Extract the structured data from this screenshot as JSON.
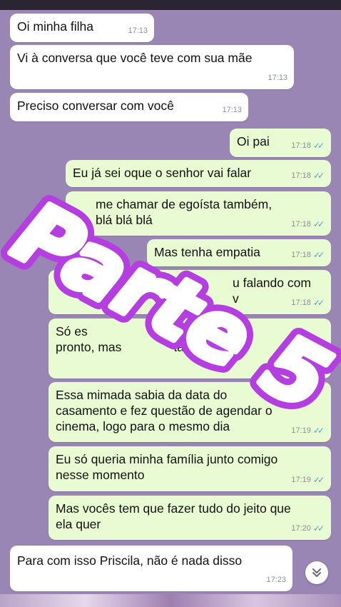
{
  "messages": [
    {
      "dir": "in",
      "text": "Oi minha filha",
      "time": "17:13"
    },
    {
      "dir": "in",
      "text": "Vi à conversa que você teve com sua mãe",
      "time": "17:13"
    },
    {
      "dir": "in",
      "text": "Preciso conversar com você",
      "time": "17:13"
    },
    {
      "dir": "out",
      "text": "Oi pai",
      "time": "17:18"
    },
    {
      "dir": "out",
      "text": "Eu já sei oque o senhor vai falar",
      "time": "17:18"
    },
    {
      "dir": "out",
      "text": "me chamar de egoísta também,\nblá blá blá",
      "time": "17:18"
    },
    {
      "dir": "out",
      "text": "Mas tenha empatia",
      "time": "17:18"
    },
    {
      "dir": "out",
      "text": "u falando com\nv",
      "time": "17:18"
    },
    {
      "dir": "out",
      "text": "Só es                       ar\npronto, mas               ta",
      "time": ""
    },
    {
      "dir": "out",
      "text": "Essa mimada sabia da data do\ncasamento e fez questão de agendar o\ncinema, logo para o mesmo dia",
      "time": "17:19"
    },
    {
      "dir": "out",
      "text": "Eu só queria minha família junto comigo\nnesse momento",
      "time": "17:19"
    },
    {
      "dir": "out",
      "text": "Mas vocês tem que fazer tudo do jeito que\nela quer",
      "time": "17:20"
    },
    {
      "dir": "in",
      "text": "Para com isso Priscila, não é nada disso",
      "time": "17:23"
    }
  ],
  "overlay_text": "Parte 5",
  "icons": {
    "read_receipt": "double-check-icon",
    "scroll_down": "chevron-double-down-icon"
  },
  "colors": {
    "background": "#9a86b5",
    "incoming": "#ffffff",
    "outgoing": "#e8fbd2",
    "tick": "#4aa3df",
    "overlay_stroke": "#b43ee0"
  }
}
